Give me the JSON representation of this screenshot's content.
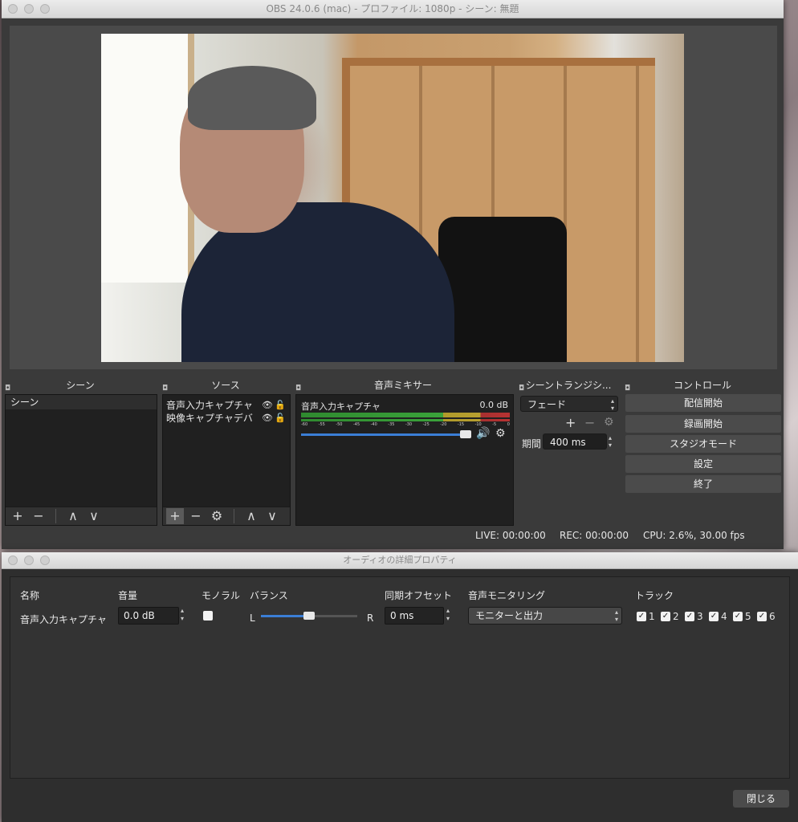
{
  "obs": {
    "title": "OBS 24.0.6 (mac) - プロファイル: 1080p - シーン: 無題",
    "docks": {
      "scenes": "シーン",
      "sources": "ソース",
      "mixer": "音声ミキサー",
      "transitions": "シーントランジシ...",
      "controls": "コントロール"
    },
    "scenes": [
      "シーン"
    ],
    "sources": [
      "音声入力キャプチャ",
      "映像キャプチャデバ"
    ],
    "toolbar": {
      "add": "+",
      "remove": "−",
      "up": "∧",
      "down": "∨",
      "gear": "⚙"
    },
    "mixer": {
      "name": "音声入力キャプチャ",
      "db": "0.0 dB",
      "scale": [
        "-60",
        "-55",
        "-50",
        "-45",
        "-40",
        "-35",
        "-30",
        "-25",
        "-20",
        "-15",
        "-10",
        "-5",
        "0"
      ],
      "volume_fraction": 1.0
    },
    "transition": {
      "type": "フェード",
      "duration_label": "期間",
      "duration_value": "400 ms"
    },
    "controls": [
      "配信開始",
      "録画開始",
      "スタジオモード",
      "設定",
      "終了"
    ],
    "status": {
      "live": "LIVE: 00:00:00",
      "rec": "REC: 00:00:00",
      "cpu": "CPU: 2.6%, 30.00 fps"
    }
  },
  "audio_props": {
    "title": "オーディオの詳細プロパティ",
    "headers": {
      "name": "名称",
      "volume": "音量",
      "mono": "モノラル",
      "balance": "バランス",
      "sync": "同期オフセット",
      "monitoring": "音声モニタリング",
      "tracks": "トラック"
    },
    "row": {
      "name": "音声入力キャプチャ",
      "volume": "0.0 dB",
      "balance_left": "L",
      "balance_right": "R",
      "balance_fraction": 0.5,
      "sync": "0 ms",
      "monitoring": "モニターと出力",
      "tracks": [
        "1",
        "2",
        "3",
        "4",
        "5",
        "6"
      ]
    },
    "close": "閉じる"
  }
}
